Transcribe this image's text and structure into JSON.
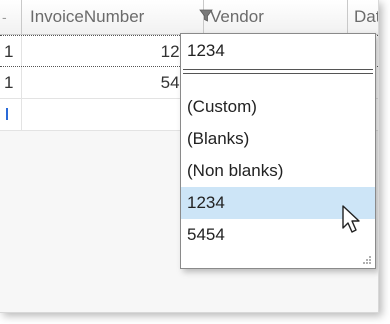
{
  "grid": {
    "columns": [
      {
        "label": "-"
      },
      {
        "label": "InvoiceNumber"
      },
      {
        "label": "Vendor"
      },
      {
        "label": "Dat"
      }
    ],
    "rows": [
      {
        "marker": "1",
        "invoice": "123",
        "date": "/"
      },
      {
        "marker": "1",
        "invoice": "545",
        "date": "/"
      }
    ]
  },
  "filter_popup": {
    "search_value": "1234",
    "items": [
      {
        "label": "(Custom)"
      },
      {
        "label": "(Blanks)"
      },
      {
        "label": "(Non blanks)"
      },
      {
        "label": "1234"
      },
      {
        "label": "5454"
      }
    ],
    "selected_index": 3
  },
  "colors": {
    "selected_bg": "#cde5f7",
    "new_row_marker": "#2a6ad8"
  }
}
